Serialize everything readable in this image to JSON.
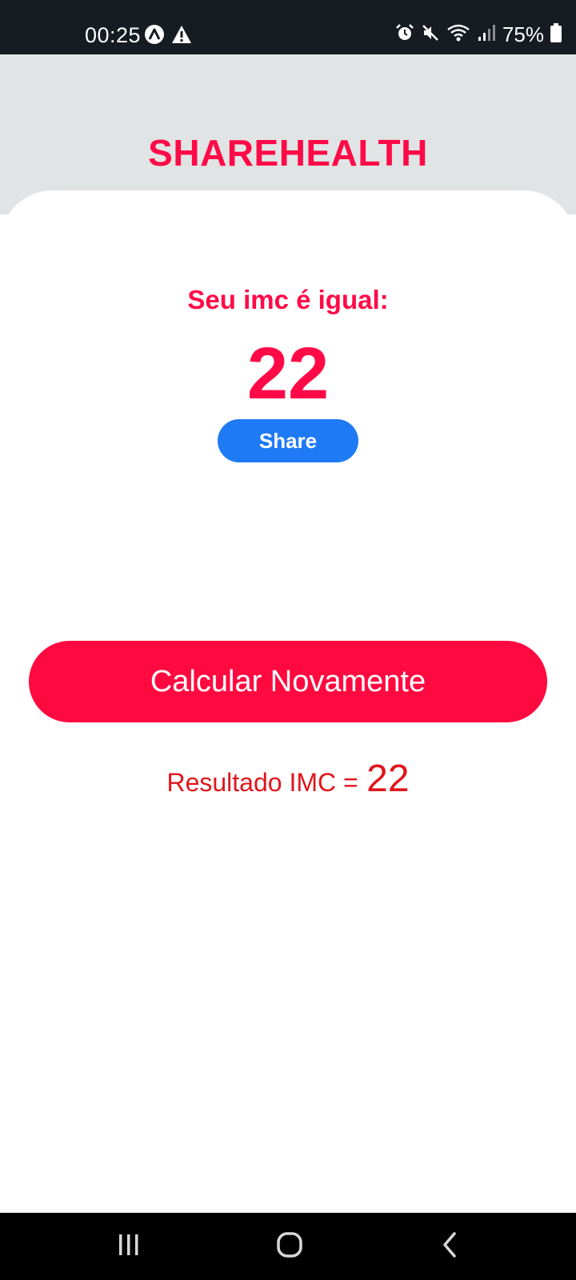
{
  "status_bar": {
    "time": "00:25",
    "battery": "75%",
    "icons": [
      "vpn-icon",
      "warning-icon",
      "alarm-icon",
      "mute-icon",
      "wifi-icon",
      "signal-icon",
      "battery-icon"
    ]
  },
  "header": {
    "title": "SHAREHEALTH"
  },
  "result_card": {
    "label": "Seu imc é igual:",
    "value": "22",
    "share_label": "Share"
  },
  "actions": {
    "recalculate_label": "Calcular Novamente"
  },
  "result_summary": {
    "label": "Resultado IMC =",
    "value": "22"
  },
  "navigation": {
    "icons": [
      "recent-apps-icon",
      "home-icon",
      "back-icon"
    ]
  },
  "colors": {
    "accent": "#ff0a47",
    "share_button": "#1f7af5",
    "result_text": "#e0151c",
    "header_bg": "#e0e4e5"
  }
}
